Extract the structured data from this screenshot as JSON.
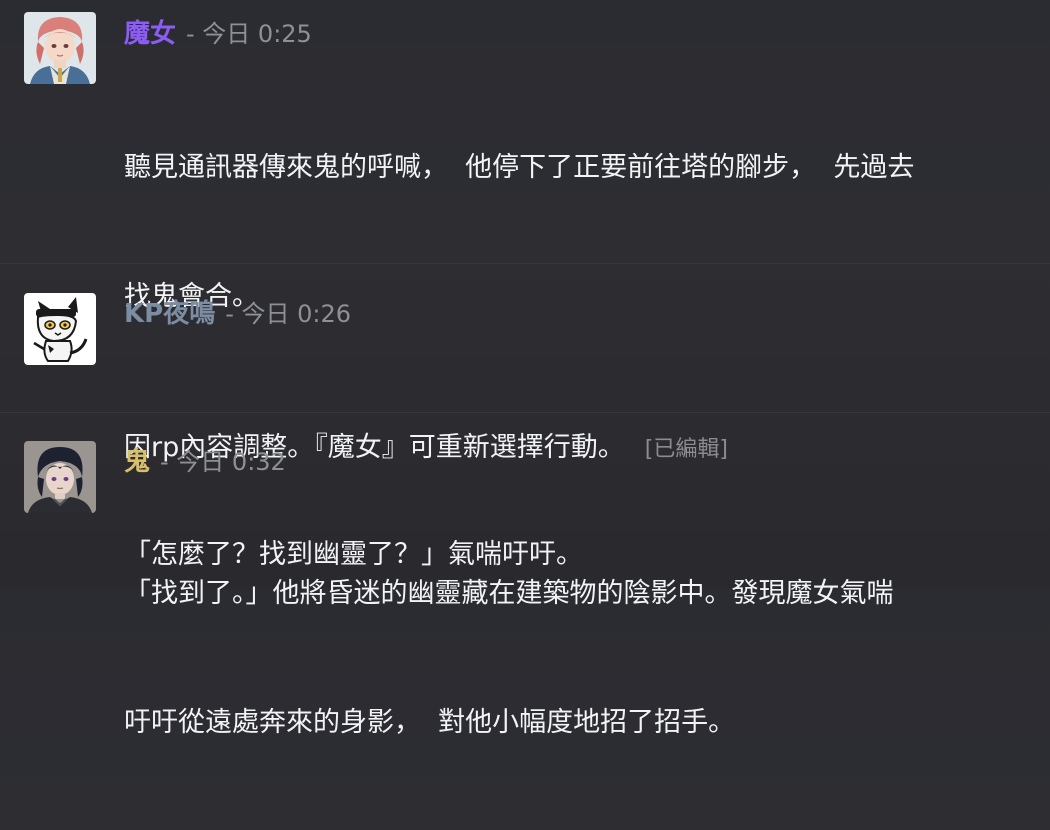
{
  "messages": [
    {
      "username": "魔女",
      "username_color": "#8b5cf6",
      "timestamp": "- 今日 0:25",
      "lines": [
        "聽見通訊器傳來鬼的呼喊，  他停下了正要前往塔的腳步，  先過去",
        "找鬼會合。",
        "",
        "「怎麼了？找到幽靈了？」氣喘吁吁。"
      ],
      "edited": ""
    },
    {
      "username": "KP夜鳴",
      "username_color": "#7b8da3",
      "timestamp": "- 今日 0:26",
      "lines": [
        "因rp內容調整。『魔女』可重新選擇行動。"
      ],
      "edited": "[已編輯]"
    },
    {
      "username": "鬼",
      "username_color": "#d8c06a",
      "timestamp": "- 今日 0:32",
      "lines": [
        "「找到了。」他將昏迷的幽靈藏在建築物的陰影中。發現魔女氣喘",
        "吁吁從遠處奔來的身影，  對他小幅度地招了招手。"
      ],
      "edited": ""
    }
  ]
}
